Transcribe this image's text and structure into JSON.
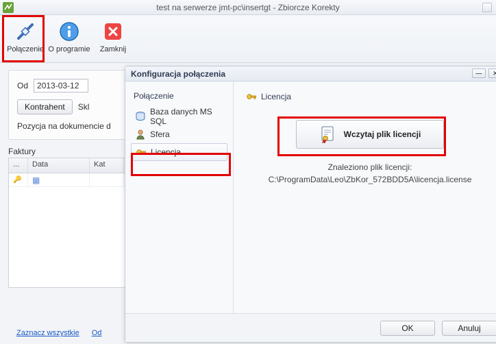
{
  "app": {
    "title": "test na serwerze jmt-pc\\insertgt - Zbiorcze Korekty"
  },
  "toolbar": {
    "connect": "Połączenie",
    "about": "O programie",
    "close": "Zamknij"
  },
  "filters": {
    "from_label": "Od",
    "from_value": "2013-03-12",
    "kontrahent_btn": "Kontrahent",
    "skl_label": "Skl",
    "doc_pos_label": "Pozycja na dokumencie d"
  },
  "grid": {
    "title": "Faktury",
    "cols": {
      "c0": "...",
      "c1": "Data",
      "c2": "Kat"
    }
  },
  "links": {
    "select_all": "Zaznacz wszystkie",
    "odz": "Od"
  },
  "dialog": {
    "title": "Konfiguracja połączenia",
    "nav_header": "Połączenie",
    "nav": {
      "db": "Baza danych MS SQL",
      "sfera": "Sfera",
      "licencja": "Licencja"
    },
    "pane": {
      "title": "Licencja",
      "load_btn": "Wczytaj plik licencji",
      "found_label": "Znaleziono plik licencji:",
      "path": "C:\\ProgramData\\Leo\\ZbKor_572BDD5A\\licencja.license"
    },
    "buttons": {
      "ok": "OK",
      "cancel": "Anuluj"
    }
  },
  "colors": {
    "highlight": "#e20000"
  }
}
